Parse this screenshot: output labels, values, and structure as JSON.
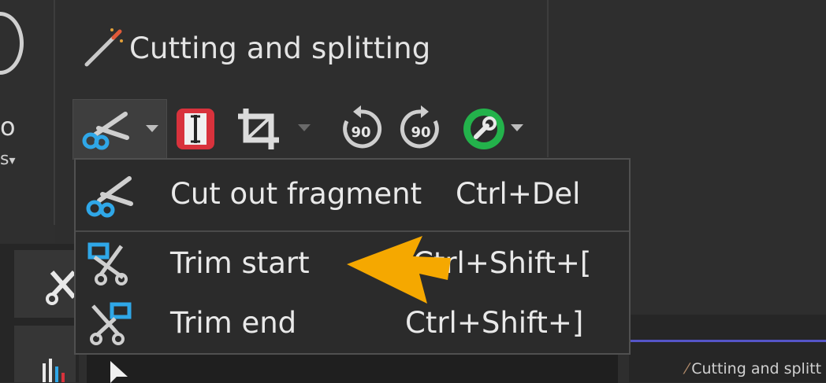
{
  "ribbon": {
    "group_title": "Cutting and splitting",
    "left_partial_label_top": "o",
    "left_partial_label_bottom": "s",
    "rotate_left_label": "90",
    "rotate_right_label": "90"
  },
  "menu": {
    "items": [
      {
        "label": "Cut out fragment",
        "shortcut": "Ctrl+Del",
        "icon": "scissors-icon"
      },
      {
        "label": "Trim start",
        "shortcut": "Ctrl+Shift+[",
        "icon": "trim-start-icon"
      },
      {
        "label": "Trim end",
        "shortcut": "Ctrl+Shift+]",
        "icon": "trim-end-icon"
      }
    ]
  },
  "bottom": {
    "mini_title": "Cutting and splitt"
  },
  "colors": {
    "accent_arrow": "#f5a800",
    "green_tool": "#23b24b",
    "red_tool": "#d8323c",
    "blue_icon": "#2fa7e8"
  }
}
